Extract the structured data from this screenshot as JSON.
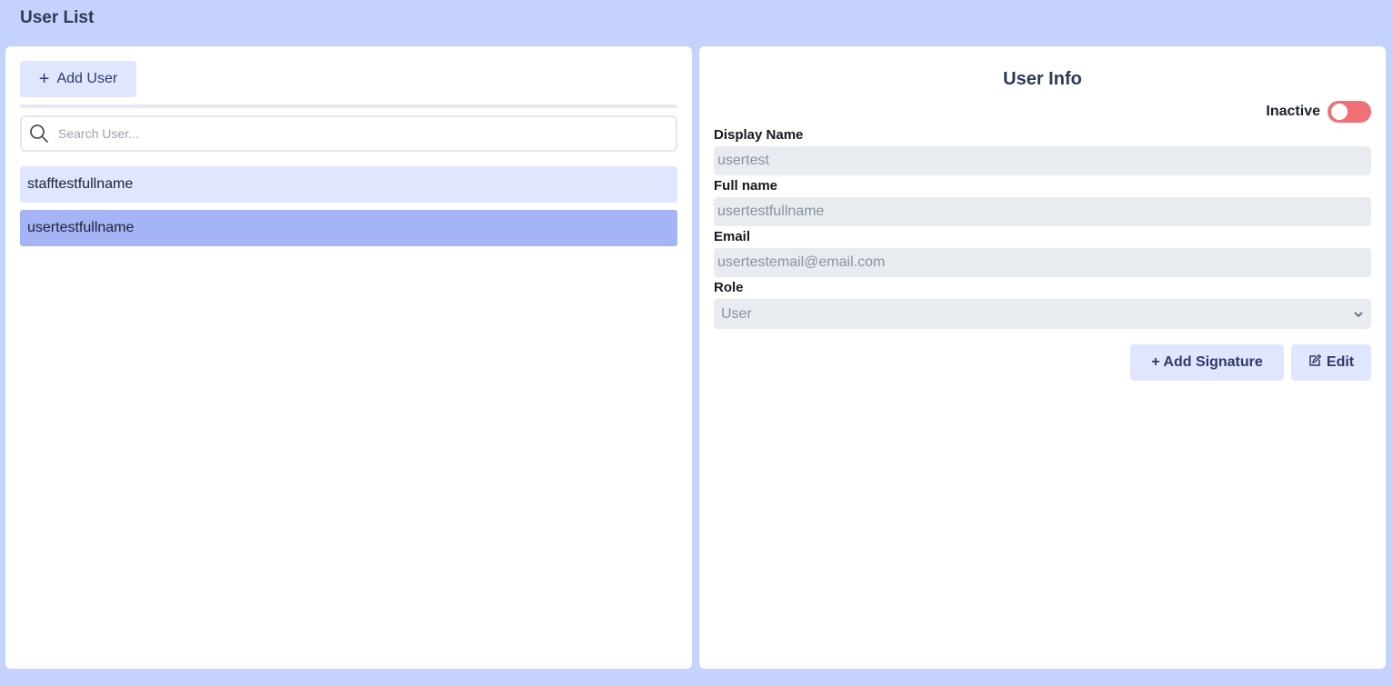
{
  "header": {
    "title": "User List"
  },
  "left_panel": {
    "add_user_label": "Add User",
    "search_placeholder": "Search User...",
    "users": [
      {
        "name": "stafftestfullname",
        "selected": false
      },
      {
        "name": "usertestfullname",
        "selected": true
      }
    ]
  },
  "right_panel": {
    "title": "User Info",
    "status_label": "Inactive",
    "status_active": false,
    "fields": {
      "display_name_label": "Display Name",
      "display_name_value": "usertest",
      "full_name_label": "Full name",
      "full_name_value": "usertestfullname",
      "email_label": "Email",
      "email_value": "usertestemail@email.com",
      "role_label": "Role",
      "role_value": "User"
    },
    "add_signature_label": "+ Add Signature",
    "edit_label": "Edit"
  },
  "colors": {
    "background": "#c5d2fb",
    "button_bg": "#dfe6fd",
    "selected_row": "#a4b4f5",
    "toggle_inactive": "#f07078",
    "input_bg": "#e8ecf1"
  },
  "icons": [
    "plus-icon",
    "search-icon",
    "chevron-down-icon",
    "edit-icon"
  ]
}
